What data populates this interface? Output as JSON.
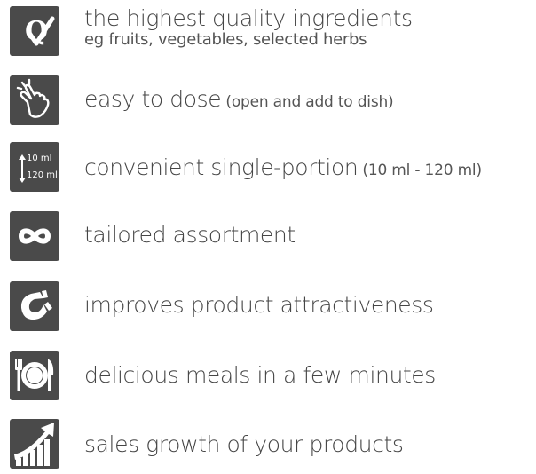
{
  "features": [
    {
      "icon": "quality-q-icon",
      "text": "the highest quality ingredients",
      "subtext": "eg fruits, vegetables, selected herbs"
    },
    {
      "icon": "hand-tap-icon",
      "text": "easy to dose",
      "note": "(open and add to dish)"
    },
    {
      "icon": "volume-range-icon",
      "icon_top": "10 ml",
      "icon_bottom": "120 ml",
      "text": "convenient single-portion",
      "note": "(10 ml - 120 ml)"
    },
    {
      "icon": "infinity-icon",
      "text": "tailored assortment"
    },
    {
      "icon": "magnet-icon",
      "text": "improves product attractiveness"
    },
    {
      "icon": "plate-cutlery-icon",
      "text": "delicious meals in a few minutes"
    },
    {
      "icon": "growth-chart-icon",
      "text": "sales growth of your products"
    }
  ],
  "colors": {
    "icon_bg": "#4a4a4a",
    "icon_fg": "#ffffff",
    "text": "#454545"
  }
}
